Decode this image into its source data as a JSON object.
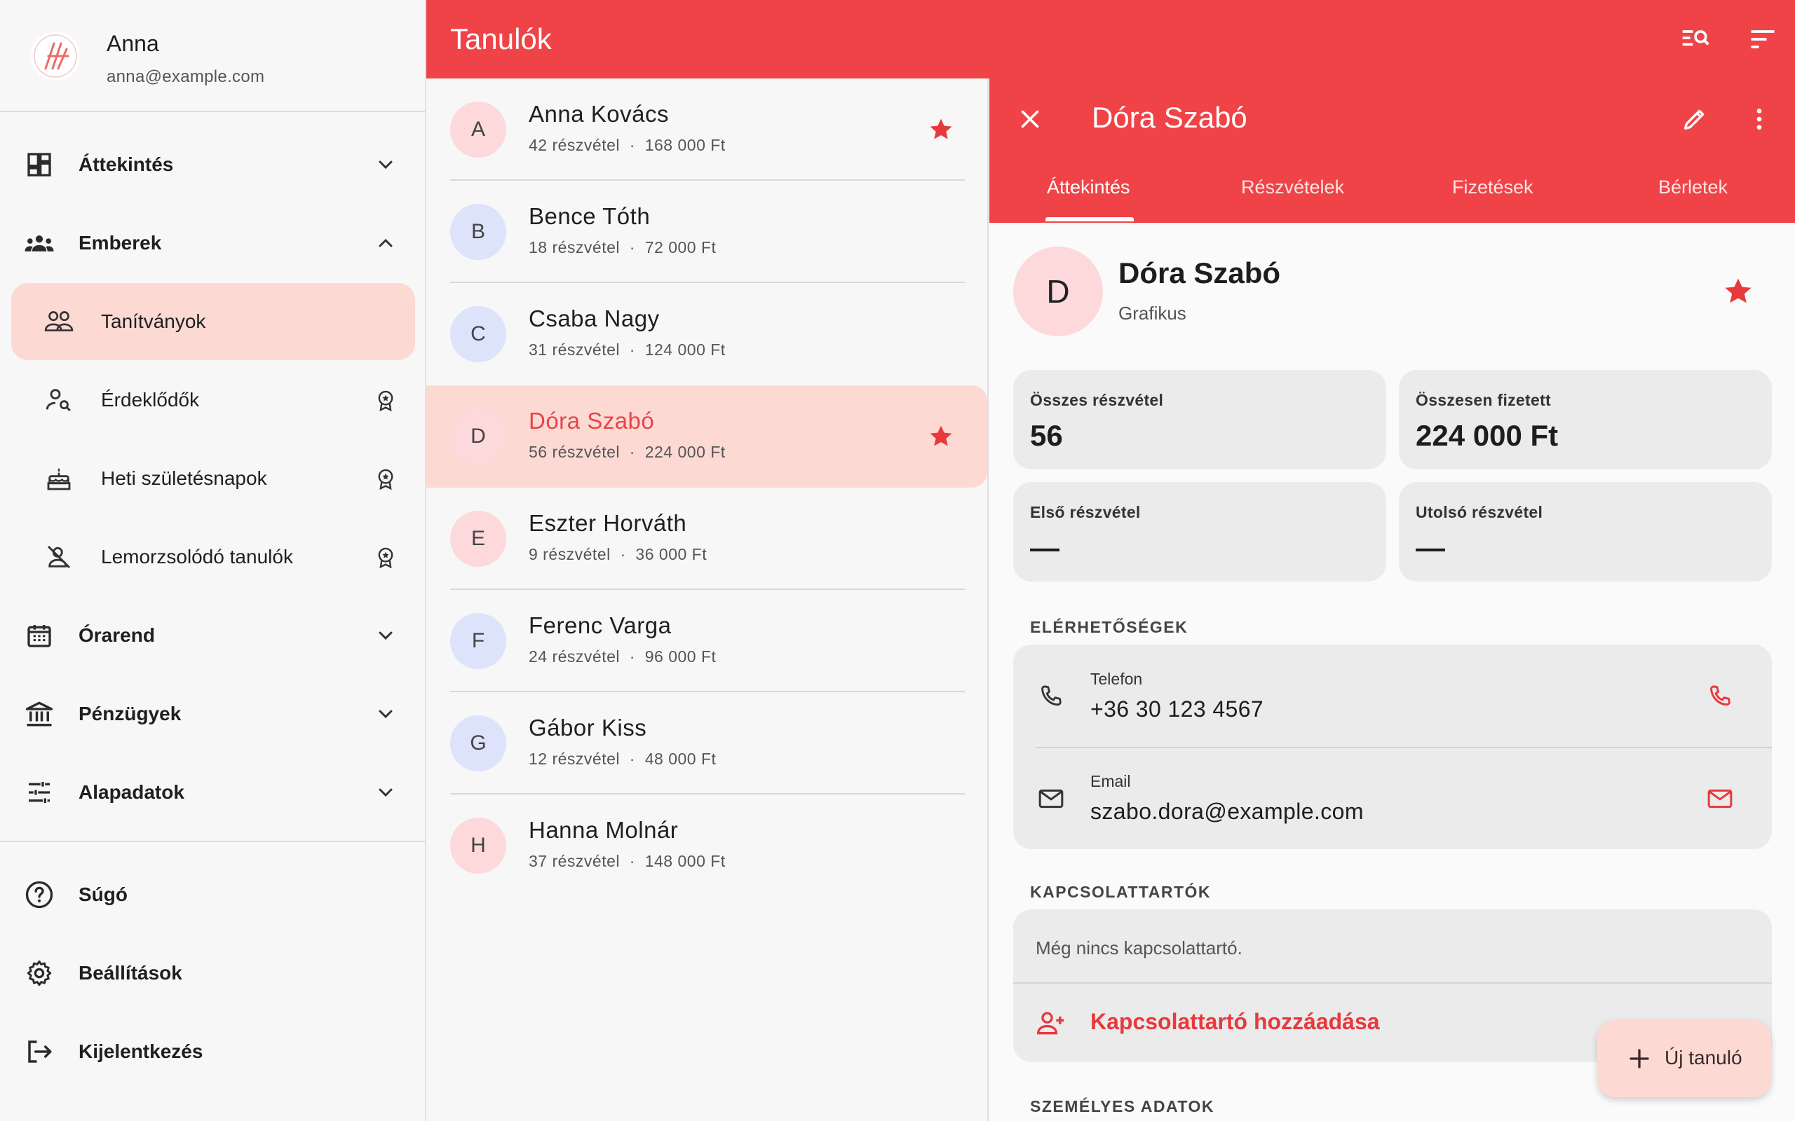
{
  "account": {
    "name": "Anna",
    "email": "anna@example.com"
  },
  "nav": {
    "overview": "Áttekintés",
    "people": "Emberek",
    "people_sub": [
      {
        "label": "Tanítványok"
      },
      {
        "label": "Érdeklődők"
      },
      {
        "label": "Heti születésnapok"
      },
      {
        "label": "Lemorzsolódó tanulók"
      }
    ],
    "schedule": "Órarend",
    "finance": "Pénzügyek",
    "basedata": "Alapadatok",
    "help": "Súgó",
    "settings": "Beállítások",
    "logout": "Kijelentkezés"
  },
  "topbar": {
    "title": "Tanulók"
  },
  "students": [
    {
      "initial": "A",
      "name": "Anna Kovács",
      "meta": "42 részvétel  ·  168 000 Ft",
      "starred": true
    },
    {
      "initial": "B",
      "name": "Bence Tóth",
      "meta": "18 részvétel  ·  72 000 Ft",
      "starred": false
    },
    {
      "initial": "C",
      "name": "Csaba Nagy",
      "meta": "31 részvétel  ·  124 000 Ft",
      "starred": false
    },
    {
      "initial": "D",
      "name": "Dóra Szabó",
      "meta": "56 részvétel  ·  224 000 Ft",
      "starred": true
    },
    {
      "initial": "E",
      "name": "Eszter Horváth",
      "meta": "9 részvétel  ·  36 000 Ft",
      "starred": false
    },
    {
      "initial": "F",
      "name": "Ferenc Varga",
      "meta": "24 részvétel  ·  96 000 Ft",
      "starred": false
    },
    {
      "initial": "G",
      "name": "Gábor Kiss",
      "meta": "12 részvétel  ·  48 000 Ft",
      "starred": false
    },
    {
      "initial": "H",
      "name": "Hanna Molnár",
      "meta": "37 részvétel  ·  148 000 Ft",
      "starred": false
    }
  ],
  "detail": {
    "title": "Dóra Szabó",
    "tabs": [
      "Áttekintés",
      "Részvételek",
      "Fizetések",
      "Bérletek"
    ],
    "initial": "D",
    "name": "Dóra Szabó",
    "job": "Grafikus",
    "stats": [
      {
        "label": "Összes részvétel",
        "value": "56"
      },
      {
        "label": "Összesen fizetett",
        "value": "224 000 Ft"
      },
      {
        "label": "Első részvétel",
        "value": "—"
      },
      {
        "label": "Utolsó részvétel",
        "value": "—"
      }
    ],
    "contacts_title": "ELÉRHETŐSÉGEK",
    "phone_label": "Telefon",
    "phone": "+36 30 123 4567",
    "email_label": "Email",
    "email": "szabo.dora@example.com",
    "contacts_people_title": "KAPCSOLATTARTÓK",
    "no_contact": "Még nincs kapcsolattartó.",
    "add_contact": "Kapcsolattartó hozzáadása",
    "personal_title": "SZEMÉLYES ADATOK"
  },
  "fab": {
    "label": "Új tanuló"
  },
  "colors": {
    "accent": "#f04347",
    "selected": "#fdd9d4",
    "star": "#e8393c"
  }
}
